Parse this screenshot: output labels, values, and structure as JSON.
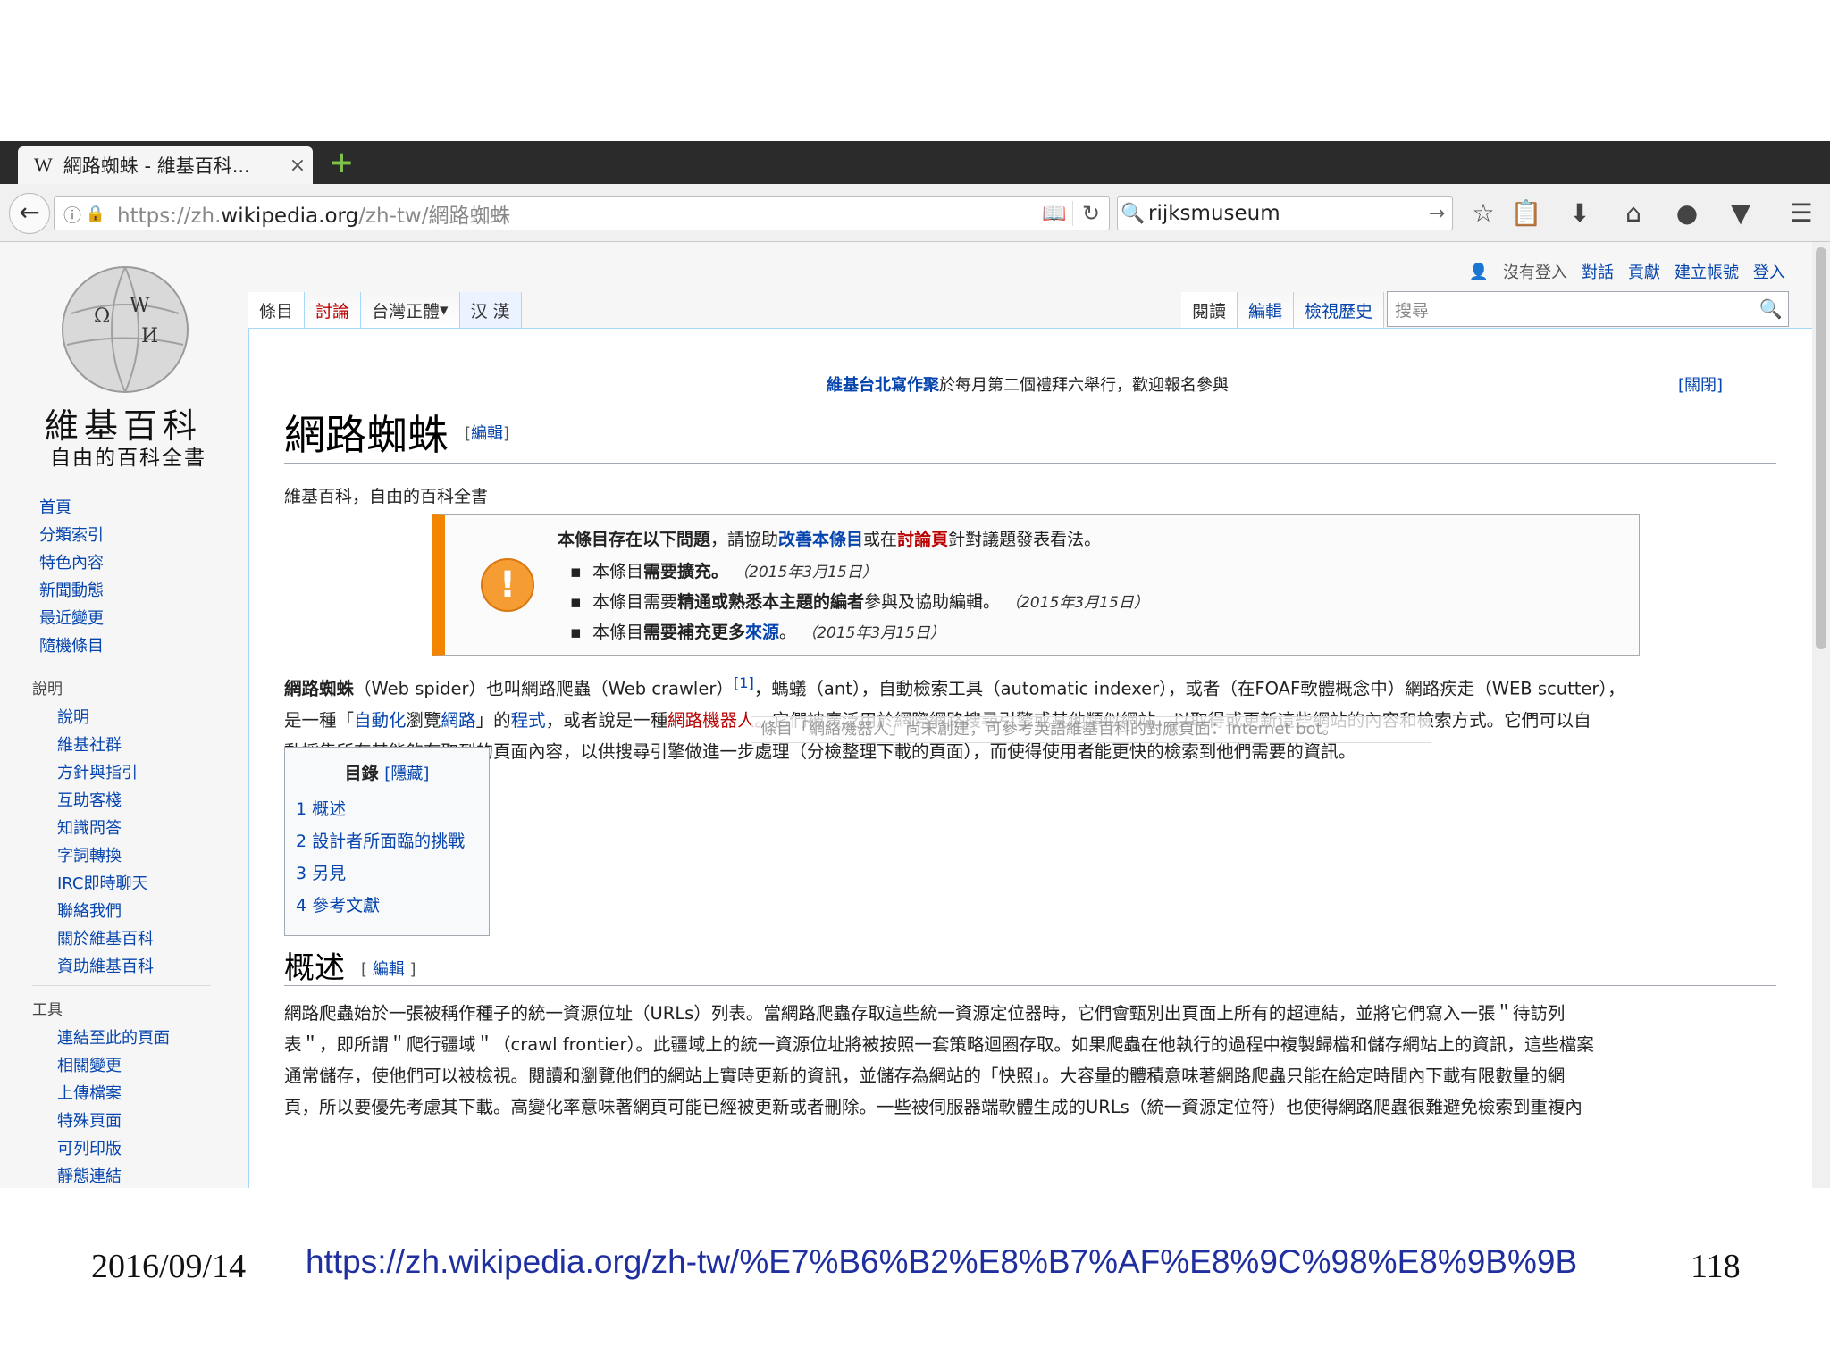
{
  "slide": {
    "date": "2016/09/14",
    "url": "https://zh.wikipedia.org/zh-tw/%E7%B6%B2%E8%B7%AF%E8%9C%98%E8%9B%9B",
    "page_number": "118"
  },
  "browser": {
    "tab": {
      "icon": "W",
      "title": "網路蜘蛛 - 維基百科...",
      "close": "×"
    },
    "new_tab": "+",
    "address": {
      "prefix": "https://zh.",
      "domain": "wikipedia.org",
      "path": "/zh-tw/網路蜘蛛"
    },
    "search_query": "rijksmuseum",
    "toolbar_icons": [
      "star-icon",
      "clipboard-icon",
      "download-icon",
      "home-icon",
      "chat-icon",
      "pocket-icon",
      "menu-icon"
    ]
  },
  "wiki": {
    "logo_title": "維基百科",
    "logo_subtitle": "自由的百科全書",
    "personal": {
      "status": "沒有登入",
      "talk": "對話",
      "contrib": "貢獻",
      "create": "建立帳號",
      "login": "登入"
    },
    "tabs_left": {
      "article": "條目",
      "talk": "討論",
      "variant": "台灣正體",
      "han": "汉 漢"
    },
    "tabs_right": {
      "read": "閱讀",
      "edit": "編輯",
      "history": "檢視歷史"
    },
    "search_placeholder": "搜尋",
    "sidebar_main": [
      "首頁",
      "分類索引",
      "特色內容",
      "新聞動態",
      "最近變更",
      "隨機條目"
    ],
    "help_heading": "說明",
    "sidebar_help": [
      "說明",
      "維基社群",
      "方針與指引",
      "互助客棧",
      "知識問答",
      "字詞轉換",
      "IRC即時聊天",
      "聯絡我們",
      "關於維基百科",
      "資助維基百科"
    ],
    "tools_heading": "工具",
    "sidebar_tools": [
      "連結至此的頁面",
      "相關變更",
      "上傳檔案",
      "特殊頁面",
      "可列印版",
      "靜態連結"
    ],
    "sitenotice": {
      "link": "維基台北寫作聚",
      "text": "於每月第二個禮拜六舉行，歡迎報名參與",
      "close": "[關閉]"
    },
    "title": "網路蜘蛛",
    "title_edit": "編輯",
    "tagline": "維基百科，自由的百科全書",
    "ambox": {
      "title_a": "本條目存在以下問題",
      "title_b": "，請協助",
      "title_link1": "改善本條目",
      "title_c": "或在",
      "title_link2": "討論頁",
      "title_d": "針對議題發表看法。",
      "items": [
        {
          "a": "本條目",
          "b": "需要擴充。",
          "date": "（2015年3月15日）"
        },
        {
          "a": "本條目需要",
          "b": "精通或熟悉本主題的編者",
          "c": "參與及協助編輯。",
          "date": "（2015年3月15日）"
        },
        {
          "a": "本條目",
          "b": "需要補充更多",
          "link": "來源",
          "c": "。",
          "date": "（2015年3月15日）"
        }
      ]
    },
    "intro": {
      "l1a": "網路蜘蛛",
      "l1b": "（Web spider）也叫網路爬蟲（Web crawler）",
      "ref": "[1]",
      "l1c": "，螞蟻（ant），自動檢索工具（automatic indexer），或者（在FOAF軟體概念中）網路疾走（WEB scutter），",
      "l2a": "是一種「",
      "l2link1": "自動化",
      "l2b": "瀏覽",
      "l2link2": "網路",
      "l2c": "」的",
      "l2link3": "程式",
      "l2d": "，或者說是一種",
      "l2red": "網路機器人",
      "l2e": "。它們被廣泛用於網際網路搜尋引擎或其他類似網站，以取得或更新這些網站的內容和檢索方式。它們可以自",
      "l3": "動採集所有其能夠存取到的頁面內容，以供搜尋引擎做進一步處理（分檢整理下載的頁面），而使得使用者能更快的檢索到他們需要的資訊。"
    },
    "tooltip": "條目「網絡機器人」尚未創建，可參考英語維基百科的對應頁面：Internet bot。",
    "toc": {
      "title": "目錄",
      "hide": "[隱藏]",
      "items": [
        "1  概述",
        "2  設計者所面臨的挑戰",
        "3  另見",
        "4  參考文獻"
      ]
    },
    "section": {
      "title": "概述",
      "edit": "編輯"
    },
    "overview": [
      "網路爬蟲始於一張被稱作種子的統一資源位址（URLs）列表。當網路爬蟲存取這些統一資源定位器時，它們會甄別出頁面上所有的超連結，並將它們寫入一張＂待訪列",
      "表＂，即所謂＂爬行疆域＂（crawl frontier）。此疆域上的統一資源位址將被按照一套策略迴圈存取。如果爬蟲在他執行的過程中複製歸檔和儲存網站上的資訊，這些檔案",
      "通常儲存，使他們可以被檢視。閱讀和瀏覽他們的網站上實時更新的資訊，並儲存為網站的「快照」。大容量的體積意味著網路爬蟲只能在給定時間內下載有限數量的網",
      "頁，所以要優先考慮其下載。高變化率意味著網頁可能已經被更新或者刪除。一些被伺服器端軟體生成的URLs（統一資源定位符）也使得網路爬蟲很難避免檢索到重複內"
    ]
  }
}
